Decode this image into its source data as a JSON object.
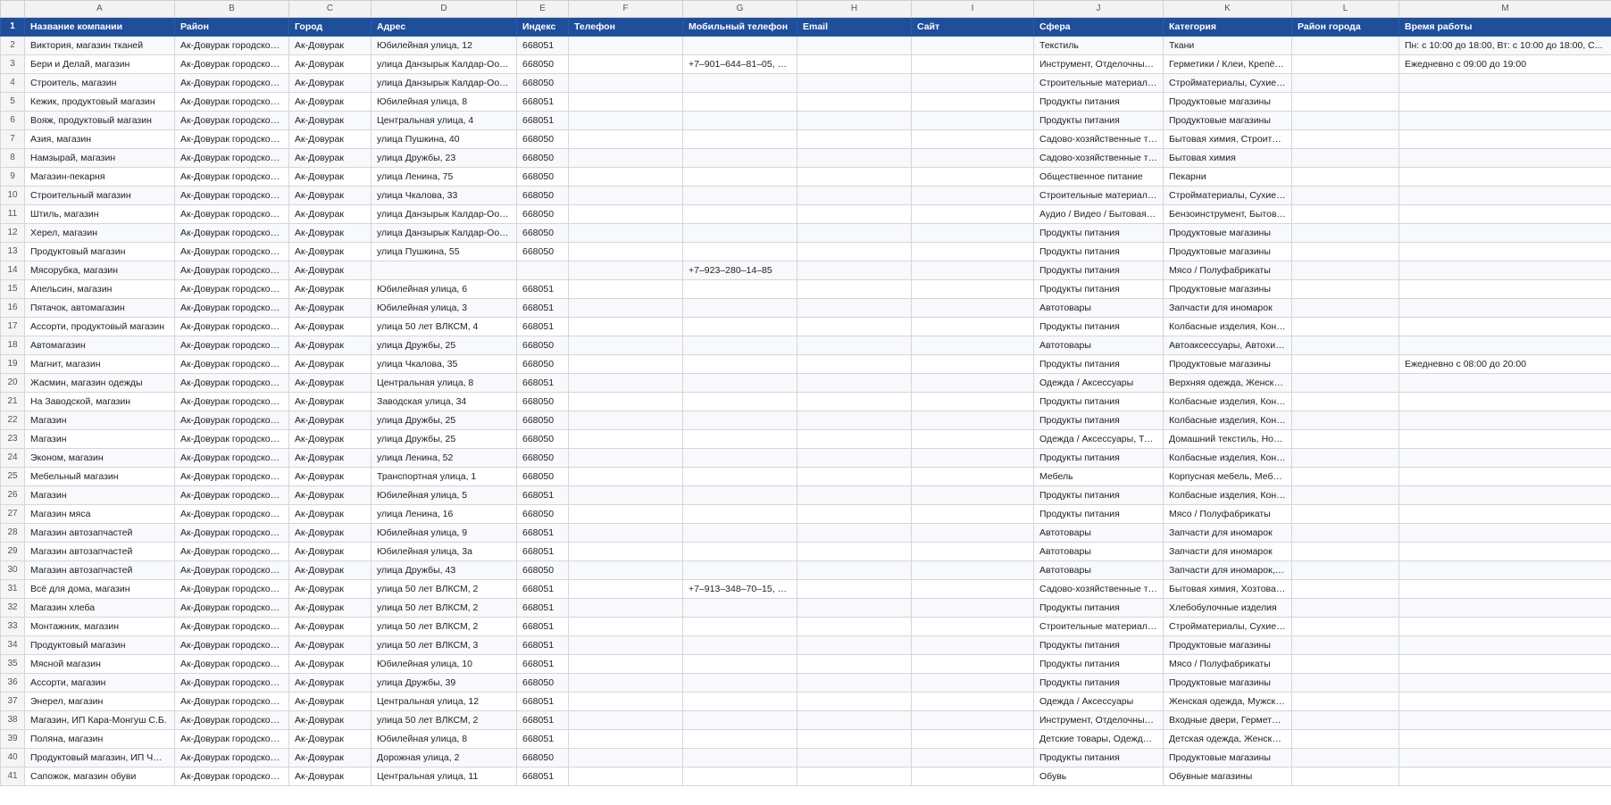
{
  "columns": [
    "A",
    "B",
    "C",
    "D",
    "E",
    "F",
    "G",
    "H",
    "I",
    "J",
    "K",
    "L",
    "M"
  ],
  "header_row": {
    "num": "1",
    "cells": [
      "Название компании",
      "Район",
      "Город",
      "Адрес",
      "Индекс",
      "Телефон",
      "Мобильный телефон",
      "Email",
      "Сайт",
      "Сфера",
      "Категория",
      "Район города",
      "Время работы"
    ]
  },
  "rows": [
    {
      "num": "2",
      "cells": [
        "Виктория, магазин тканей",
        "Ак-Довурак городской...",
        "Ак-Довурак",
        "Юбилейная улица, 12",
        "668051",
        "",
        "",
        "",
        "",
        "Текстиль",
        "Ткани",
        "",
        "Пн: с 10:00 до 18:00, Вт: с 10:00 до 18:00, С..."
      ]
    },
    {
      "num": "3",
      "cells": [
        "Бери и Делай, магазин",
        "Ак-Довурак городской...",
        "Ак-Довурак",
        "улица Данзырык Калдар-Оола...",
        "668050",
        "",
        "+7–901–644–81–05, +7...",
        "",
        "",
        "Инструмент, Отделочные ...",
        "Герметики / Клеи, Крепёж,...",
        "",
        "Ежедневно с 09:00 до 19:00"
      ]
    },
    {
      "num": "4",
      "cells": [
        "Строитель, магазин",
        "Ак-Довурак городской...",
        "Ак-Довурак",
        "улица Данзырык Калдар-Оола...",
        "668050",
        "",
        "",
        "",
        "",
        "Строительные материалы ...",
        "Стройматериалы, Сухие ст...",
        "",
        ""
      ]
    },
    {
      "num": "5",
      "cells": [
        "Кежик, продуктовый магазин",
        "Ак-Довурак городской...",
        "Ак-Довурак",
        "Юбилейная улица, 8",
        "668051",
        "",
        "",
        "",
        "",
        "Продукты питания",
        "Продуктовые магазины",
        "",
        ""
      ]
    },
    {
      "num": "6",
      "cells": [
        "Вояж, продуктовый магазин",
        "Ак-Довурак городской...",
        "Ак-Довурак",
        "Центральная улица, 4",
        "668051",
        "",
        "",
        "",
        "",
        "Продукты питания",
        "Продуктовые магазины",
        "",
        ""
      ]
    },
    {
      "num": "7",
      "cells": [
        "Азия, магазин",
        "Ак-Довурак городской...",
        "Ак-Довурак",
        "улица Пушкина, 40",
        "668050",
        "",
        "",
        "",
        "",
        "Садово-хозяйственные то...",
        "Бытовая химия, Строитель...",
        "",
        ""
      ]
    },
    {
      "num": "8",
      "cells": [
        "Намзырай, магазин",
        "Ак-Довурак городской...",
        "Ак-Довурак",
        "улица Дружбы, 23",
        "668050",
        "",
        "",
        "",
        "",
        "Садово-хозяйственные то...",
        "Бытовая химия",
        "",
        ""
      ]
    },
    {
      "num": "9",
      "cells": [
        "Магазин-пекарня",
        "Ак-Довурак городской...",
        "Ак-Довурак",
        "улица Ленина, 75",
        "668050",
        "",
        "",
        "",
        "",
        "Общественное питание",
        "Пекарни",
        "",
        ""
      ]
    },
    {
      "num": "10",
      "cells": [
        "Строительный магазин",
        "Ак-Довурак городской...",
        "Ак-Довурак",
        "улица Чкалова, 33",
        "668050",
        "",
        "",
        "",
        "",
        "Строительные материалы ...",
        "Стройматериалы, Сухие ст...",
        "",
        ""
      ]
    },
    {
      "num": "11",
      "cells": [
        "Штиль, магазин",
        "Ак-Довурак городской...",
        "Ак-Довурак",
        "улица Данзырык Калдар-Оола...",
        "668050",
        "",
        "",
        "",
        "",
        "Аудио / Видео / Бытовая т...",
        "Бензоинструмент, Бытовая...",
        "",
        ""
      ]
    },
    {
      "num": "12",
      "cells": [
        "Херел, магазин",
        "Ак-Довурак городской...",
        "Ак-Довурак",
        "улица Данзырык Калдар-Оола...",
        "668050",
        "",
        "",
        "",
        "",
        "Продукты питания",
        "Продуктовые магазины",
        "",
        ""
      ]
    },
    {
      "num": "13",
      "cells": [
        "Продуктовый магазин",
        "Ак-Довурак городской...",
        "Ак-Довурак",
        "улица Пушкина, 55",
        "668050",
        "",
        "",
        "",
        "",
        "Продукты питания",
        "Продуктовые магазины",
        "",
        ""
      ]
    },
    {
      "num": "14",
      "cells": [
        "Мясорубка, магазин",
        "Ак-Довурак городской...",
        "Ак-Довурак",
        "",
        "",
        "",
        "+7–923–280–14–85",
        "",
        "",
        "Продукты питания",
        "Мясо / Полуфабрикаты",
        "",
        ""
      ]
    },
    {
      "num": "15",
      "cells": [
        "Апельсин, магазин",
        "Ак-Довурак городской...",
        "Ак-Довурак",
        "Юбилейная улица, 6",
        "668051",
        "",
        "",
        "",
        "",
        "Продукты питания",
        "Продуктовые магазины",
        "",
        ""
      ]
    },
    {
      "num": "16",
      "cells": [
        "Пятачок, автомагазин",
        "Ак-Довурак городской...",
        "Ак-Довурак",
        "Юбилейная улица, 3",
        "668051",
        "",
        "",
        "",
        "",
        "Автотовары",
        "Запчасти для иномарок",
        "",
        ""
      ]
    },
    {
      "num": "17",
      "cells": [
        "Ассорти, продуктовый магазин",
        "Ак-Довурак городской...",
        "Ак-Довурак",
        "улица 50 лет ВЛКСМ, 4",
        "668051",
        "",
        "",
        "",
        "",
        "Продукты питания",
        "Колбасные изделия, Конд...",
        "",
        ""
      ]
    },
    {
      "num": "18",
      "cells": [
        "Автомагазин",
        "Ак-Довурак городской...",
        "Ак-Довурак",
        "улица Дружбы, 25",
        "668050",
        "",
        "",
        "",
        "",
        "Автотовары",
        "Автоаксессуары, Автохими...",
        "",
        ""
      ]
    },
    {
      "num": "19",
      "cells": [
        "Магнит, магазин",
        "Ак-Довурак городской...",
        "Ак-Довурак",
        "улица Чкалова, 35",
        "668050",
        "",
        "",
        "",
        "",
        "Продукты питания",
        "Продуктовые магазины",
        "",
        "Ежедневно с 08:00 до 20:00"
      ]
    },
    {
      "num": "20",
      "cells": [
        "Жасмин, магазин одежды",
        "Ак-Довурак городской...",
        "Ак-Довурак",
        "Центральная улица, 8",
        "668051",
        "",
        "",
        "",
        "",
        "Одежда / Аксессуары",
        "Верхняя одежда, Женская ...",
        "",
        ""
      ]
    },
    {
      "num": "21",
      "cells": [
        "На Заводской, магазин",
        "Ак-Довурак городской...",
        "Ак-Довурак",
        "Заводская улица, 34",
        "668050",
        "",
        "",
        "",
        "",
        "Продукты питания",
        "Колбасные изделия, Конд...",
        "",
        ""
      ]
    },
    {
      "num": "22",
      "cells": [
        "Магазин",
        "Ак-Довурак городской...",
        "Ак-Довурак",
        "улица Дружбы, 25",
        "668050",
        "",
        "",
        "",
        "",
        "Продукты питания",
        "Колбасные изделия, Конд...",
        "",
        ""
      ]
    },
    {
      "num": "23",
      "cells": [
        "Магазин",
        "Ак-Довурак городской...",
        "Ак-Довурак",
        "улица Дружбы, 25",
        "668050",
        "",
        "",
        "",
        "",
        "Одежда / Аксессуары, Тек...",
        "Домашний текстиль, Носк...",
        "",
        ""
      ]
    },
    {
      "num": "24",
      "cells": [
        "Эконом, магазин",
        "Ак-Довурак городской...",
        "Ак-Довурак",
        "улица Ленина, 52",
        "668050",
        "",
        "",
        "",
        "",
        "Продукты питания",
        "Колбасные изделия, Конд...",
        "",
        ""
      ]
    },
    {
      "num": "25",
      "cells": [
        "Мебельный магазин",
        "Ак-Довурак городской...",
        "Ак-Довурак",
        "Транспортная улица, 1",
        "668050",
        "",
        "",
        "",
        "",
        "Мебель",
        "Корпусная мебель, Мебел...",
        "",
        ""
      ]
    },
    {
      "num": "26",
      "cells": [
        "Магазин",
        "Ак-Довурак городской...",
        "Ак-Довурак",
        "Юбилейная улица, 5",
        "668051",
        "",
        "",
        "",
        "",
        "Продукты питания",
        "Колбасные изделия, Конд...",
        "",
        ""
      ]
    },
    {
      "num": "27",
      "cells": [
        "Магазин мяса",
        "Ак-Довурак городской...",
        "Ак-Довурак",
        "улица Ленина, 16",
        "668050",
        "",
        "",
        "",
        "",
        "Продукты питания",
        "Мясо / Полуфабрикаты",
        "",
        ""
      ]
    },
    {
      "num": "28",
      "cells": [
        "Магазин автозапчастей",
        "Ак-Довурак городской...",
        "Ак-Довурак",
        "Юбилейная улица, 9",
        "668051",
        "",
        "",
        "",
        "",
        "Автотовары",
        "Запчасти для иномарок",
        "",
        ""
      ]
    },
    {
      "num": "29",
      "cells": [
        "Магазин автозапчастей",
        "Ак-Довурак городской...",
        "Ак-Довурак",
        "Юбилейная улица, 3а",
        "668051",
        "",
        "",
        "",
        "",
        "Автотовары",
        "Запчасти для иномарок",
        "",
        ""
      ]
    },
    {
      "num": "30",
      "cells": [
        "Магазин автозапчастей",
        "Ак-Довурак городской...",
        "Ак-Довурак",
        "улица Дружбы, 43",
        "668050",
        "",
        "",
        "",
        "",
        "Автотовары",
        "Запчасти для иномарок, З...",
        "",
        ""
      ]
    },
    {
      "num": "31",
      "cells": [
        "Всё для дома, магазин",
        "Ак-Довурак городской...",
        "Ак-Довурак",
        "улица 50 лет ВЛКСМ, 2",
        "668051",
        "",
        "+7–913–348–70–15, +7...",
        "",
        "",
        "Садово-хозяйственные то...",
        "Бытовая химия, Хозтовары",
        "",
        ""
      ]
    },
    {
      "num": "32",
      "cells": [
        "Магазин хлеба",
        "Ак-Довурак городской...",
        "Ак-Довурак",
        "улица 50 лет ВЛКСМ, 2",
        "668051",
        "",
        "",
        "",
        "",
        "Продукты питания",
        "Хлебобулочные изделия",
        "",
        ""
      ]
    },
    {
      "num": "33",
      "cells": [
        "Монтажник, магазин",
        "Ак-Довурак городской...",
        "Ак-Довурак",
        "улица 50 лет ВЛКСМ, 2",
        "668051",
        "",
        "",
        "",
        "",
        "Строительные материалы ...",
        "Стройматериалы, Сухие ст...",
        "",
        ""
      ]
    },
    {
      "num": "34",
      "cells": [
        "Продуктовый магазин",
        "Ак-Довурак городской...",
        "Ак-Довурак",
        "улица 50 лет ВЛКСМ, 3",
        "668051",
        "",
        "",
        "",
        "",
        "Продукты питания",
        "Продуктовые магазины",
        "",
        ""
      ]
    },
    {
      "num": "35",
      "cells": [
        "Мясной магазин",
        "Ак-Довурак городской...",
        "Ак-Довурак",
        "Юбилейная улица, 10",
        "668051",
        "",
        "",
        "",
        "",
        "Продукты питания",
        "Мясо / Полуфабрикаты",
        "",
        ""
      ]
    },
    {
      "num": "36",
      "cells": [
        "Ассорти, магазин",
        "Ак-Довурак городской...",
        "Ак-Довурак",
        "улица Дружбы, 39",
        "668050",
        "",
        "",
        "",
        "",
        "Продукты питания",
        "Продуктовые магазины",
        "",
        ""
      ]
    },
    {
      "num": "37",
      "cells": [
        "Энерел, магазин",
        "Ак-Довурак городской...",
        "Ак-Довурак",
        "Центральная улица, 12",
        "668051",
        "",
        "",
        "",
        "",
        "Одежда / Аксессуары",
        "Женская одежда, Мужская...",
        "",
        ""
      ]
    },
    {
      "num": "38",
      "cells": [
        "Магазин, ИП Кара-Монгуш С.Б.",
        "Ак-Довурак городской...",
        "Ак-Довурак",
        "улица 50 лет ВЛКСМ, 2",
        "668051",
        "",
        "",
        "",
        "",
        "Инструмент, Отделочные ...",
        "Входные двери, Герметик,...",
        "",
        ""
      ]
    },
    {
      "num": "39",
      "cells": [
        "Поляна, магазин",
        "Ак-Довурак городской...",
        "Ак-Довурак",
        "Юбилейная улица, 8",
        "668051",
        "",
        "",
        "",
        "",
        "Детские товары, Одежда / ...",
        "Детская одежда, Женская ...",
        "",
        ""
      ]
    },
    {
      "num": "40",
      "cells": [
        "Продуктовый магазин, ИП Чыргал В.В.",
        "Ак-Довурак городской...",
        "Ак-Довурак",
        "Дорожная улица, 2",
        "668050",
        "",
        "",
        "",
        "",
        "Продукты питания",
        "Продуктовые магазины",
        "",
        ""
      ]
    },
    {
      "num": "41",
      "cells": [
        "Сапожок, магазин обуви",
        "Ак-Довурак городской...",
        "Ак-Довурак",
        "Центральная улица, 11",
        "668051",
        "",
        "",
        "",
        "",
        "Обувь",
        "Обувные магазины",
        "",
        ""
      ]
    }
  ]
}
